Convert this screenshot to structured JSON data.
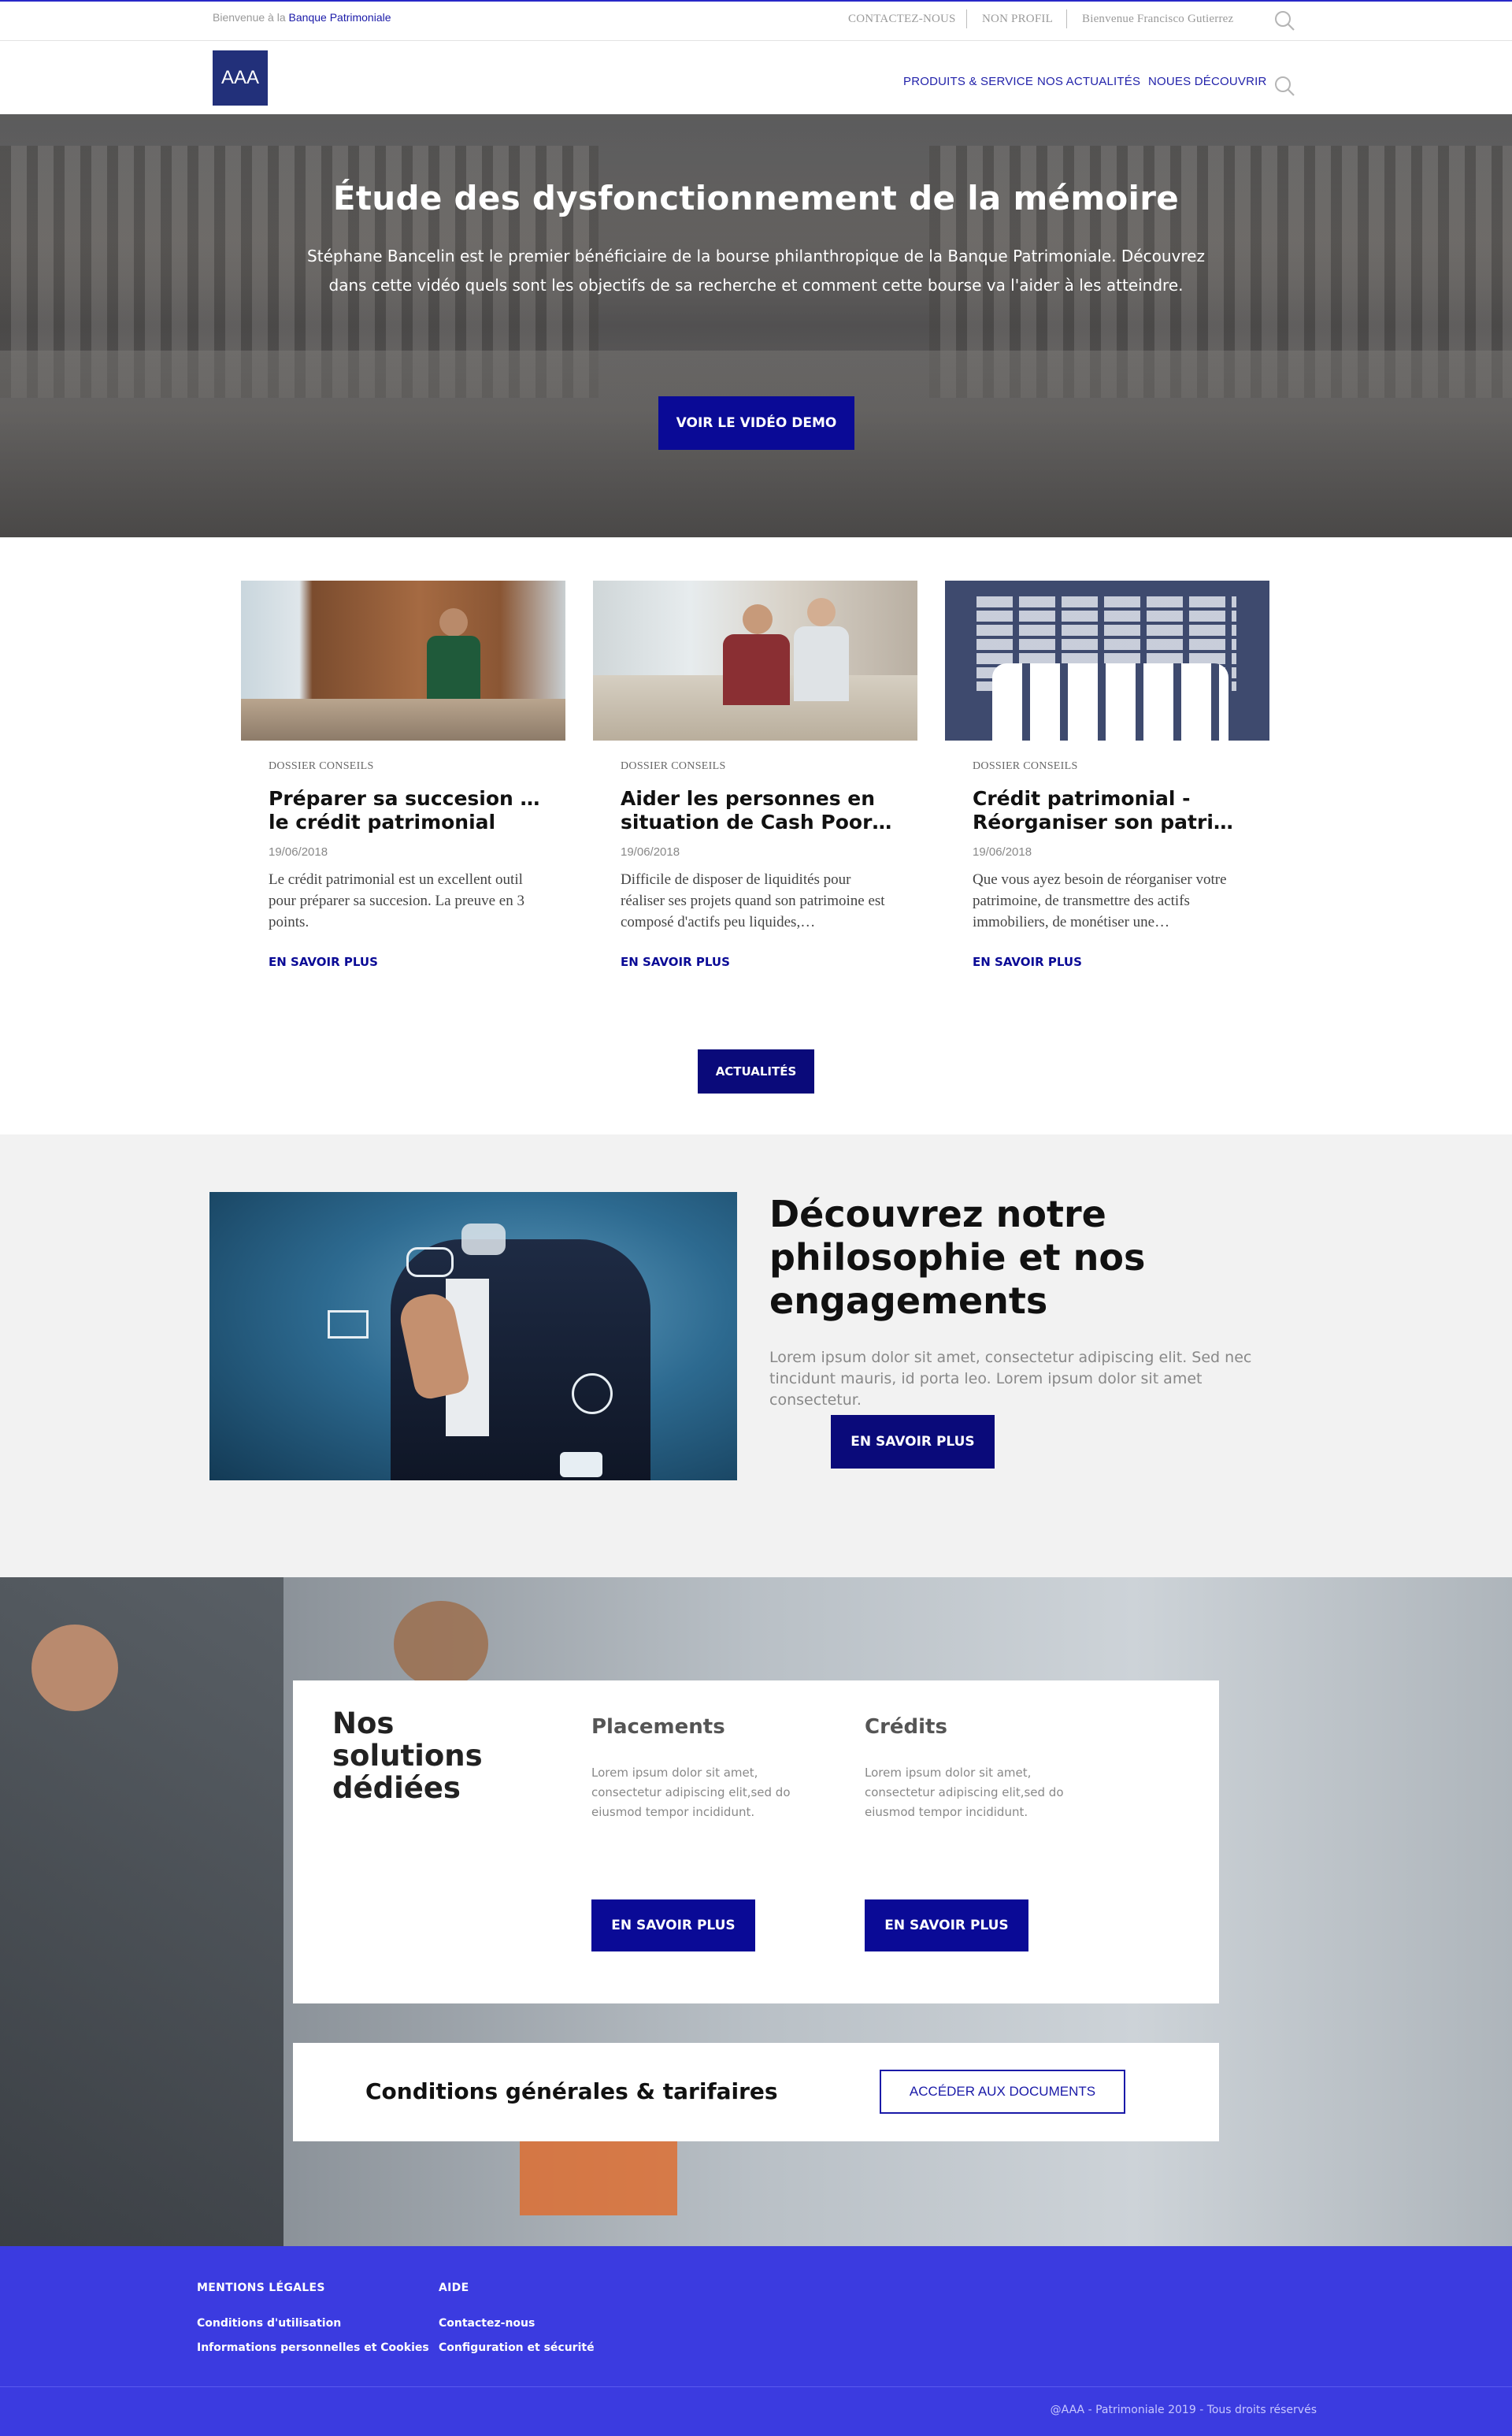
{
  "topbar": {
    "welcome_prefix": "Bienvenue à la",
    "welcome_brand": "Banque Patrimoniale",
    "links": [
      "CONTACTEZ-NOUS",
      "NON PROFIL",
      "Bienvenue Francisco Gutierrez"
    ],
    "search_icon": "search-icon"
  },
  "nav": {
    "logo": "AAA",
    "links": [
      "PRODUITS & SERVICE",
      "NOS ACTUALITÉS",
      "NOUES DÉCOUVRIR"
    ],
    "search_icon": "search-icon"
  },
  "hero": {
    "title": "Étude des dysfonctionnement de la mémoire",
    "description": "Stéphane Bancelin est le premier bénéficiaire de la bourse philanthropique de la Banque Patrimoniale. Découvrez dans cette vidéo quels sont les objectifs de sa recherche et comment cette bourse va l'aider à les atteindre.",
    "button": "VOIR LE VIDÉO DEMO"
  },
  "cards": [
    {
      "category": "DOSSIER CONSEILS",
      "title_l1": "Préparer sa succesion avec",
      "title_l2": "le crédit patrimonial",
      "date": "19/06/2018",
      "excerpt": "Le crédit patrimonial est un excellent outil pour préparer sa succesion. La preuve en 3 points.",
      "link": "EN SAVOIR PLUS"
    },
    {
      "category": "DOSSIER CONSEILS",
      "title_l1": "Aider les personnes en",
      "title_l2": "situation de Cash Poor/ Ca…",
      "date": "19/06/2018",
      "excerpt": "Difficile de disposer de liquidités pour réaliser ses projets quand son patrimoine est composé d'actifs peu liquides,…",
      "link": "EN SAVOIR PLUS"
    },
    {
      "category": "DOSSIER CONSEILS",
      "title_l1": "Crédit patrimonial -",
      "title_l2": "Réorganiser son patrimoin…",
      "date": "19/06/2018",
      "excerpt": "Que vous ayez besoin de réorganiser votre patrimoine, de transmettre des actifs immobiliers, de monétiser une…",
      "link": "EN SAVOIR PLUS"
    }
  ],
  "actualites_button": "ACTUALITÉS",
  "philosophy": {
    "title": "Découvrez notre philosophie et nos engagements",
    "text": "Lorem ipsum dolor sit amet, consectetur adipiscing elit. Sed nec tincidunt mauris, id porta leo. Lorem ipsum dolor sit amet consectetur.",
    "button": "EN SAVOIR PLUS"
  },
  "solutions": {
    "title": "Nos solutions dédiées",
    "columns": [
      {
        "heading": "Placements",
        "text": "Lorem ipsum dolor sit amet, consectetur adipiscing elit,sed do eiusmod tempor incididunt.",
        "button": "EN SAVOIR PLUS"
      },
      {
        "heading": "Crédits",
        "text": "Lorem ipsum dolor sit amet, consectetur adipiscing elit,sed do eiusmod tempor incididunt.",
        "button": "EN SAVOIR PLUS"
      }
    ]
  },
  "conditions": {
    "title": "Conditions générales & tarifaires",
    "button": "ACCÉDER AUX DOCUMENTS"
  },
  "footer": {
    "columns": [
      {
        "heading": "MENTIONS LÉGALES",
        "links": [
          "Conditions d'utilisation",
          "Informations personnelles et Cookies"
        ]
      },
      {
        "heading": "AIDE",
        "links": [
          "Contactez-nous",
          "Configuration et sécurité"
        ]
      }
    ],
    "copyright": "@AAA - Patrimoniale 2019 - Tous droits réservés"
  },
  "colors": {
    "primary": "#0a0a96",
    "footer": "#3b3be0",
    "logo": "#22307a"
  }
}
